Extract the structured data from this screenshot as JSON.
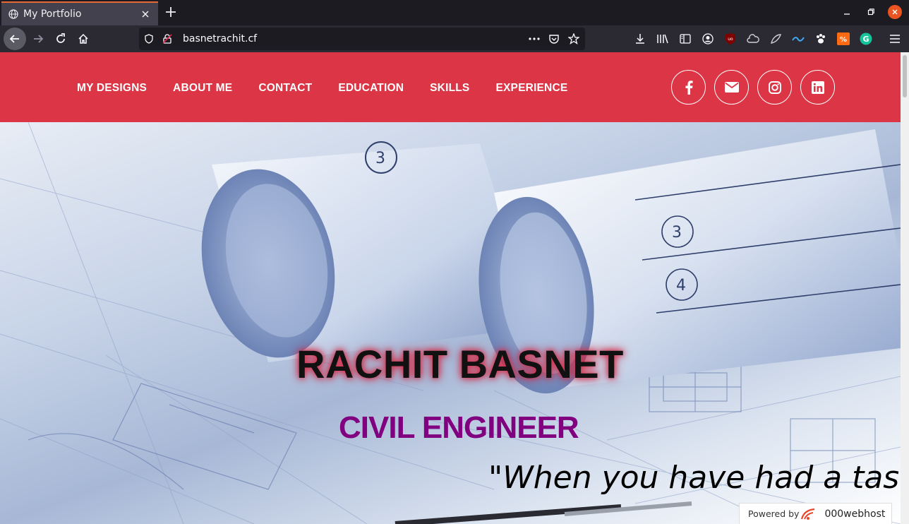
{
  "browser": {
    "tab_title": "My Portfolio",
    "url": "basnetrachit.cf"
  },
  "nav": {
    "items": [
      {
        "label": "MY DESIGNS"
      },
      {
        "label": "ABOUT ME"
      },
      {
        "label": "CONTACT"
      },
      {
        "label": "EDUCATION"
      },
      {
        "label": "SKILLS"
      },
      {
        "label": "EXPERIENCE"
      }
    ]
  },
  "socials": [
    "facebook-icon",
    "envelope-icon",
    "instagram-icon",
    "linkedin-icon"
  ],
  "hero": {
    "name": "RACHIT BASNET",
    "role": "CIVIL ENGINEER",
    "quote": "\"When you have had a tas"
  },
  "footer_badge": {
    "prefix": "Powered by",
    "brand": "000webhost"
  },
  "colors": {
    "header_bg": "#dc3545",
    "role_text": "#800080"
  }
}
